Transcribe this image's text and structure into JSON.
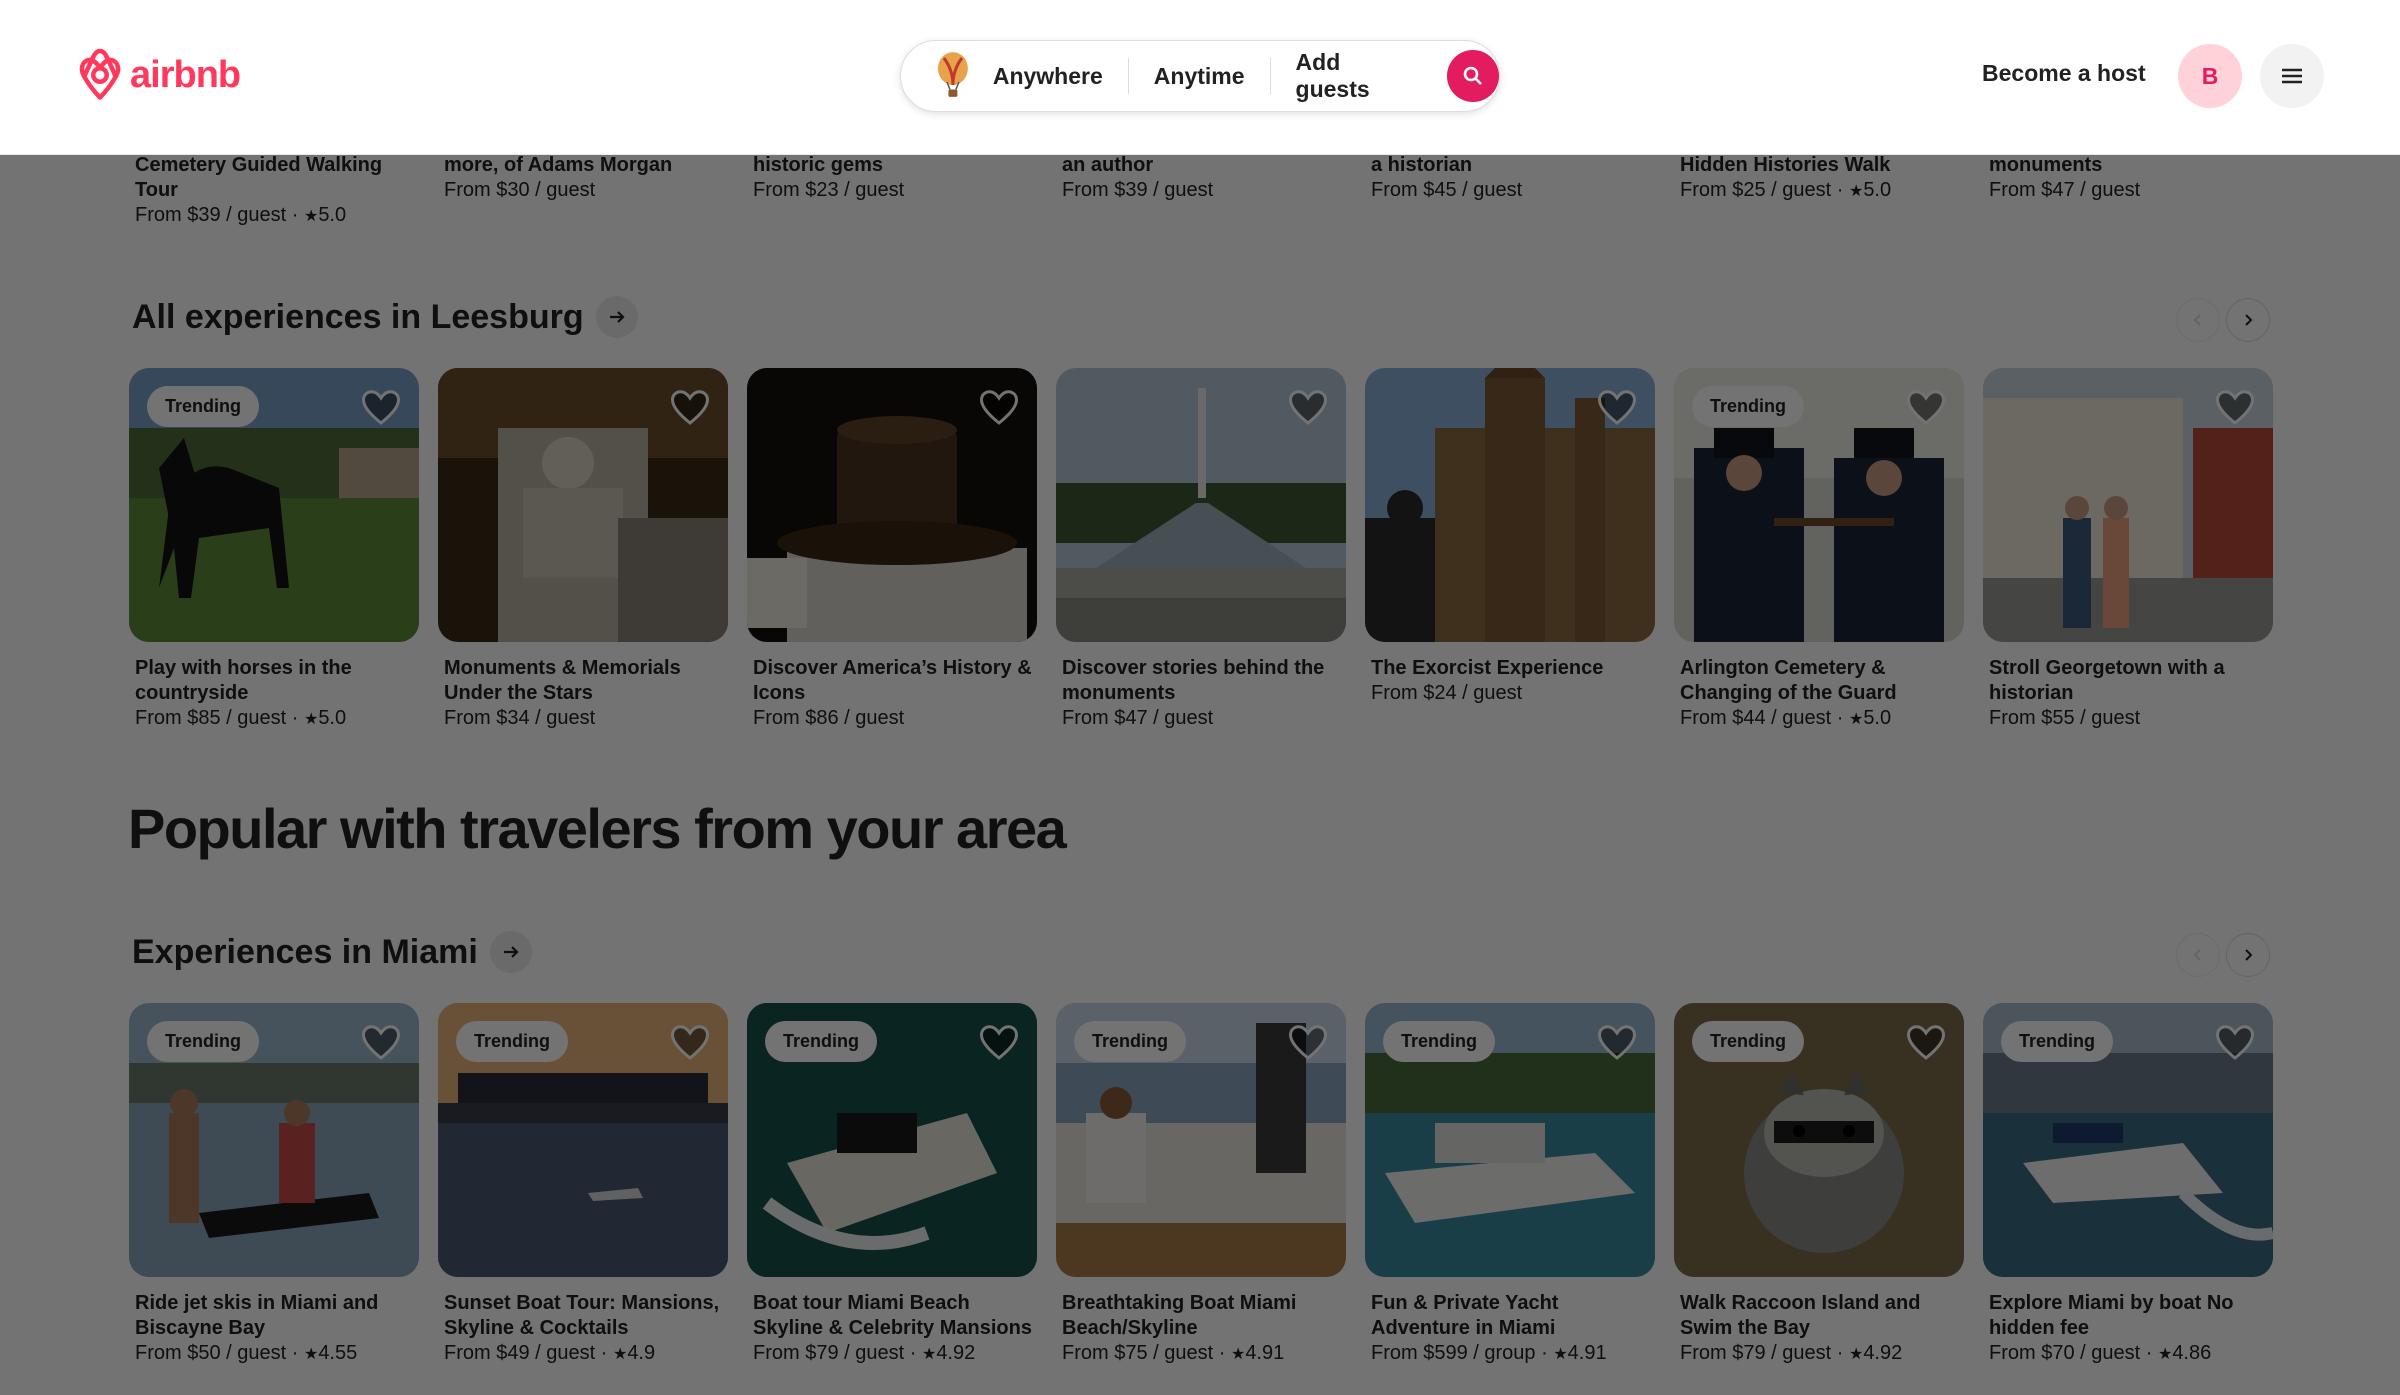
{
  "header": {
    "logo_text": "airbnb",
    "search": {
      "anywhere": "Anywhere",
      "anytime": "Anytime",
      "guests": "Add guests"
    },
    "become_host": "Become a host",
    "avatar_initial": "B"
  },
  "top_row": [
    {
      "title": "Cemetery Guided Walking Tour",
      "price": "From $39 / guest",
      "rating": "5.0"
    },
    {
      "title": "more, of Adams Morgan",
      "price": "From $30 / guest",
      "rating": ""
    },
    {
      "title": "historic gems",
      "price": "From $23 / guest",
      "rating": ""
    },
    {
      "title": "an author",
      "price": "From $39 / guest",
      "rating": ""
    },
    {
      "title": "a historian",
      "price": "From $45 / guest",
      "rating": ""
    },
    {
      "title": "Hidden Histories Walk",
      "price": "From $25 / guest",
      "rating": "5.0"
    },
    {
      "title": "monuments",
      "price": "From $47 / guest",
      "rating": ""
    }
  ],
  "section_leesburg": {
    "title": "All experiences in Leesburg",
    "cards": [
      {
        "title": "Play with horses in the countryside",
        "price": "From $85 / guest",
        "rating": "5.0",
        "badge": "Trending",
        "scene": "horse"
      },
      {
        "title": "Monuments & Memorials Under the Stars",
        "price": "From $34 / guest",
        "rating": "",
        "badge": "",
        "scene": "lincoln"
      },
      {
        "title": "Discover America’s History & Icons",
        "price": "From $86 / guest",
        "rating": "",
        "badge": "",
        "scene": "hat"
      },
      {
        "title": "Discover stories behind the monuments",
        "price": "From $47 / guest",
        "rating": "",
        "badge": "",
        "scene": "mall"
      },
      {
        "title": "The Exorcist Experience",
        "price": "From $24 / guest",
        "rating": "",
        "badge": "",
        "scene": "gothic"
      },
      {
        "title": "Arlington Cemetery & Changing of the Guard",
        "price": "From $44 / guest",
        "rating": "5.0",
        "badge": "Trending",
        "scene": "guard"
      },
      {
        "title": "Stroll Georgetown with a historian",
        "price": "From $55 / guest",
        "rating": "",
        "badge": "",
        "scene": "street"
      }
    ]
  },
  "popular_title": "Popular with travelers from your area",
  "section_miami": {
    "title": "Experiences in Miami",
    "cards": [
      {
        "title": "Ride jet skis in Miami and Biscayne Bay",
        "price": "From $50 / guest",
        "rating": "4.55",
        "badge": "Trending",
        "scene": "jetski"
      },
      {
        "title": "Sunset Boat Tour: Mansions, Skyline & Cocktails",
        "price": "From $49 / guest",
        "rating": "4.9",
        "badge": "Trending",
        "scene": "sunset"
      },
      {
        "title": "Boat tour Miami Beach Skyline & Celebrity Mansions",
        "price": "From $79 / guest",
        "rating": "4.92",
        "badge": "Trending",
        "scene": "speedboat"
      },
      {
        "title": "Breathtaking Boat Miami Beach/Skyline",
        "price": "From $75 / guest",
        "rating": "4.91",
        "badge": "Trending",
        "scene": "deck"
      },
      {
        "title": "Fun & Private Yacht Adventure in Miami",
        "price": "From $599 / group",
        "rating": "4.91",
        "badge": "Trending",
        "scene": "yacht"
      },
      {
        "title": "Walk Raccoon Island and Swim the Bay",
        "price": "From $79 / guest",
        "rating": "4.92",
        "badge": "Trending",
        "scene": "raccoon"
      },
      {
        "title": "Explore Miami by boat No hidden fee",
        "price": "From $70 / guest",
        "rating": "4.86",
        "badge": "Trending",
        "scene": "bayboat"
      }
    ]
  },
  "colors": {
    "brand": "#ff385c",
    "search_button": "#e31c5f",
    "avatar_bg": "#ffd1d8"
  }
}
